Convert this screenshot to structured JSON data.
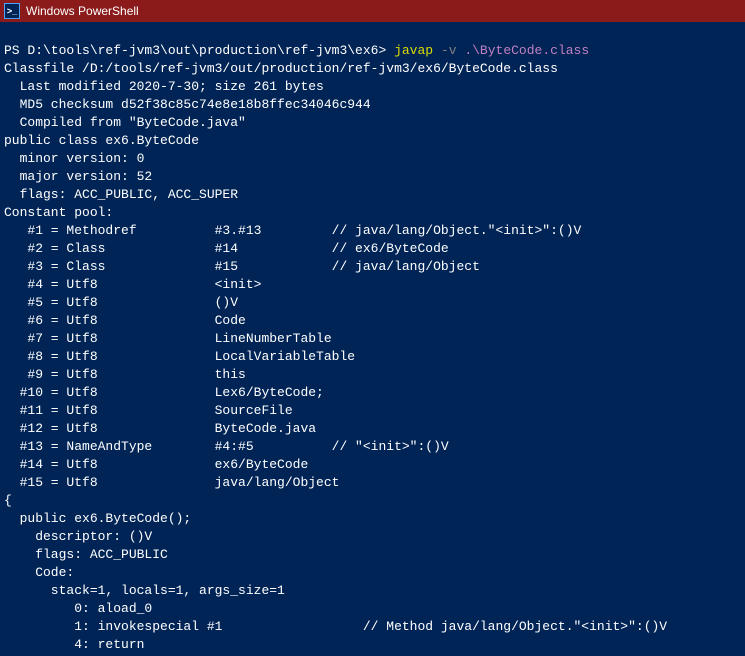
{
  "titlebar": {
    "title": "Windows PowerShell"
  },
  "prompt": {
    "path": "PS D:\\tools\\ref-jvm3\\out\\production\\ref-jvm3\\ex6>",
    "command": "javap",
    "flag": "-v",
    "arg": ".\\ByteCode.class"
  },
  "output": {
    "classfile": "Classfile /D:/tools/ref-jvm3/out/production/ref-jvm3/ex6/ByteCode.class",
    "lastmod": "  Last modified 2020-7-30; size 261 bytes",
    "md5": "  MD5 checksum d52f38c85c74e8e18b8ffec34046c944",
    "compiled": "  Compiled from \"ByteCode.java\"",
    "classdecl": "public class ex6.ByteCode",
    "minor": "  minor version: 0",
    "major": "  major version: 52",
    "flags": "  flags: ACC_PUBLIC, ACC_SUPER",
    "cpheader": "Constant pool:",
    "cp1": "   #1 = Methodref          #3.#13         // java/lang/Object.\"<init>\":()V",
    "cp2": "   #2 = Class              #14            // ex6/ByteCode",
    "cp3": "   #3 = Class              #15            // java/lang/Object",
    "cp4": "   #4 = Utf8               <init>",
    "cp5": "   #5 = Utf8               ()V",
    "cp6": "   #6 = Utf8               Code",
    "cp7": "   #7 = Utf8               LineNumberTable",
    "cp8": "   #8 = Utf8               LocalVariableTable",
    "cp9": "   #9 = Utf8               this",
    "cp10": "  #10 = Utf8               Lex6/ByteCode;",
    "cp11": "  #11 = Utf8               SourceFile",
    "cp12": "  #12 = Utf8               ByteCode.java",
    "cp13": "  #13 = NameAndType        #4:#5          // \"<init>\":()V",
    "cp14": "  #14 = Utf8               ex6/ByteCode",
    "cp15": "  #15 = Utf8               java/lang/Object",
    "brace": "{",
    "ctor": "  public ex6.ByteCode();",
    "desc": "    descriptor: ()V",
    "mflags": "    flags: ACC_PUBLIC",
    "code": "    Code:",
    "stack": "      stack=1, locals=1, args_size=1",
    "i0": "         0: aload_0",
    "i1": "         1: invokespecial #1                  // Method java/lang/Object.\"<init>\":()V",
    "i4": "         4: return"
  }
}
